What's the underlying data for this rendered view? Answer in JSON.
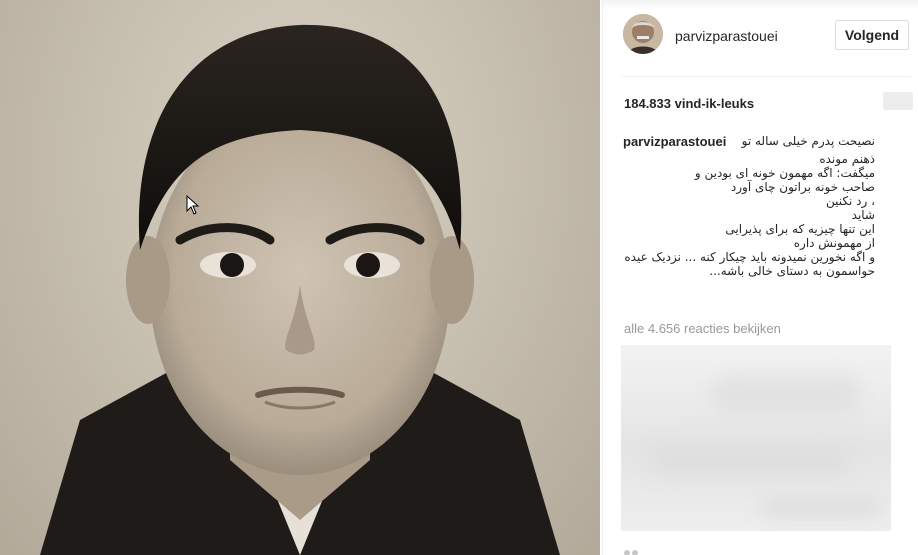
{
  "post": {
    "username": "parvizparastouei",
    "follow_label": "Volgend",
    "likes": "184.833 vind-ik-leuks",
    "caption_first": "نصیحت پدرم خیلی ساله تو",
    "caption_lines": [
      "ذهنم مونده",
      "میگفت: اگه مهمون خونه ای بودین و",
      "صاحب خونه براتون چای آورد",
      "، رد نکنین",
      "شاید",
      "این تنها چیزیه که برای پذیرایی",
      "از مهمونش داره",
      "و اگه نخورین نمیدونه باید چیکار کنه ... نزدیک عیده",
      "حواسمون به دستای خالی باشه..."
    ],
    "comments_link": "alle 4.656 reacties bekijken"
  },
  "colors": {
    "photo_bg": "#c8c0b1",
    "hair": "#1a1714",
    "skin": "#bfb2a0",
    "jacket": "#221e1b",
    "text_primary": "#262626",
    "text_muted": "#999999"
  }
}
